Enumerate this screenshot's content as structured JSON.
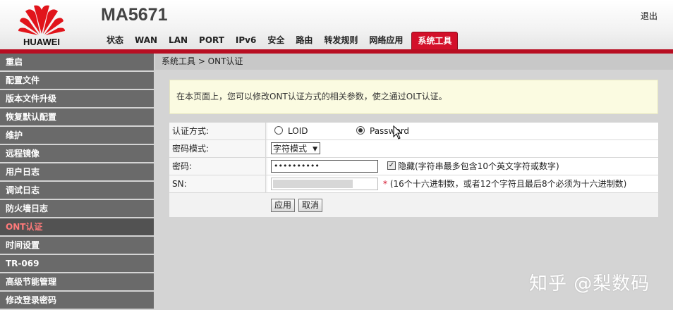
{
  "header": {
    "brand": "HUAWEI",
    "product": "MA5671",
    "logout": "退出",
    "colors": {
      "brand_red": "#d3102a",
      "header_bar": "#b80e22"
    }
  },
  "nav": {
    "items": [
      {
        "label": "状态"
      },
      {
        "label": "WAN"
      },
      {
        "label": "LAN"
      },
      {
        "label": "PORT"
      },
      {
        "label": "IPv6"
      },
      {
        "label": "安全"
      },
      {
        "label": "路由"
      },
      {
        "label": "转发规则"
      },
      {
        "label": "网络应用"
      },
      {
        "label": "系统工具",
        "active": true
      }
    ]
  },
  "sidebar": {
    "items": [
      {
        "label": "重启"
      },
      {
        "label": "配置文件"
      },
      {
        "label": "版本文件升级"
      },
      {
        "label": "恢复默认配置"
      },
      {
        "label": "维护"
      },
      {
        "label": "远程镜像"
      },
      {
        "label": "用户日志"
      },
      {
        "label": "调试日志"
      },
      {
        "label": "防火墙日志"
      },
      {
        "label": "ONT认证",
        "active": true
      },
      {
        "label": "时间设置"
      },
      {
        "label": "TR-069"
      },
      {
        "label": "高级节能管理"
      },
      {
        "label": "修改登录密码"
      }
    ]
  },
  "breadcrumb": "系统工具 > ONT认证",
  "info_text": "在本页面上，您可以修改ONT认证方式的相关参数，使之通过OLT认证。",
  "form": {
    "auth_label": "认证方式:",
    "auth_options": [
      {
        "label": "LOID",
        "checked": false
      },
      {
        "label": "Password",
        "checked": true
      }
    ],
    "pwd_mode_label": "密码模式:",
    "pwd_mode_value": "字符模式",
    "password_label": "密码:",
    "password_value": "••••••••••",
    "hide_checked": true,
    "hide_hint": "隐藏(字符串最多包含10个英文字符或数字)",
    "sn_label": "SN:",
    "sn_required": "*",
    "sn_hint": "(16个十六进制数，或者12个字符且最后8个必须为十六进制数)",
    "apply": "应用",
    "cancel": "取消"
  },
  "watermark": "知乎 @梨数码"
}
